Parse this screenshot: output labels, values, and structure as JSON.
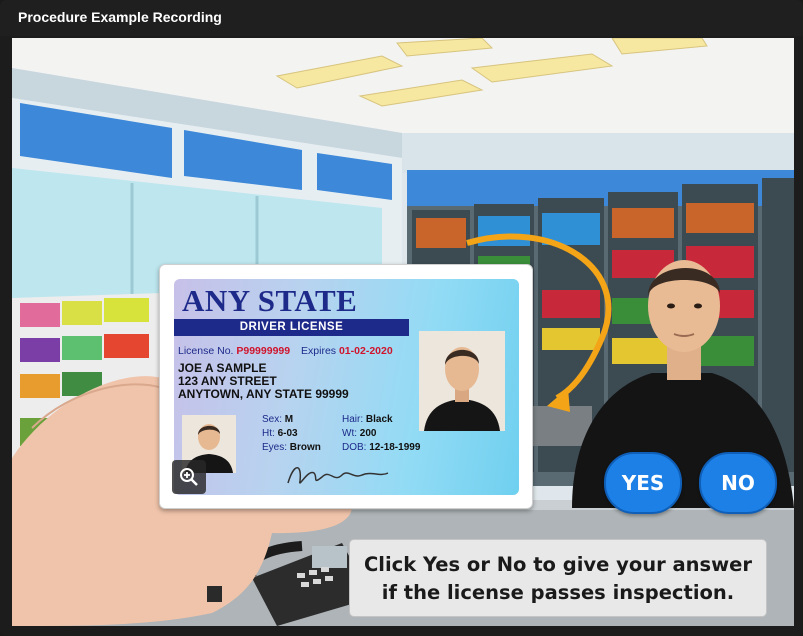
{
  "window": {
    "title": "Procedure Example Recording"
  },
  "card": {
    "state": "ANY STATE",
    "type": "DRIVER LICENSE",
    "license_label": "License No.",
    "license_number": "P99999999",
    "expires_label": "Expires",
    "expires": "01-02-2020",
    "name": "JOE A SAMPLE",
    "address1": "123 ANY STREET",
    "address2": "ANYTOWN, ANY STATE 99999",
    "sex_label": "Sex:",
    "sex": "M",
    "hair_label": "Hair:",
    "hair": "Black",
    "ht_label": "Ht:",
    "ht": "6-03",
    "wt_label": "Wt:",
    "wt": "200",
    "eyes_label": "Eyes:",
    "eyes": "Brown",
    "dob_label": "DOB:",
    "dob": "12-18-1999"
  },
  "controls": {
    "yes_label": "YES",
    "no_label": "NO"
  },
  "instruction": {
    "line1": "Click Yes or No to give your answer",
    "line2": "if the license passes inspection."
  },
  "icons": {
    "zoom": "zoom-in-icon"
  },
  "colors": {
    "button": "#1c80e6",
    "card_band": "#1d2a8a",
    "accent_red": "#d0142c",
    "arrow": "#f4a417"
  }
}
